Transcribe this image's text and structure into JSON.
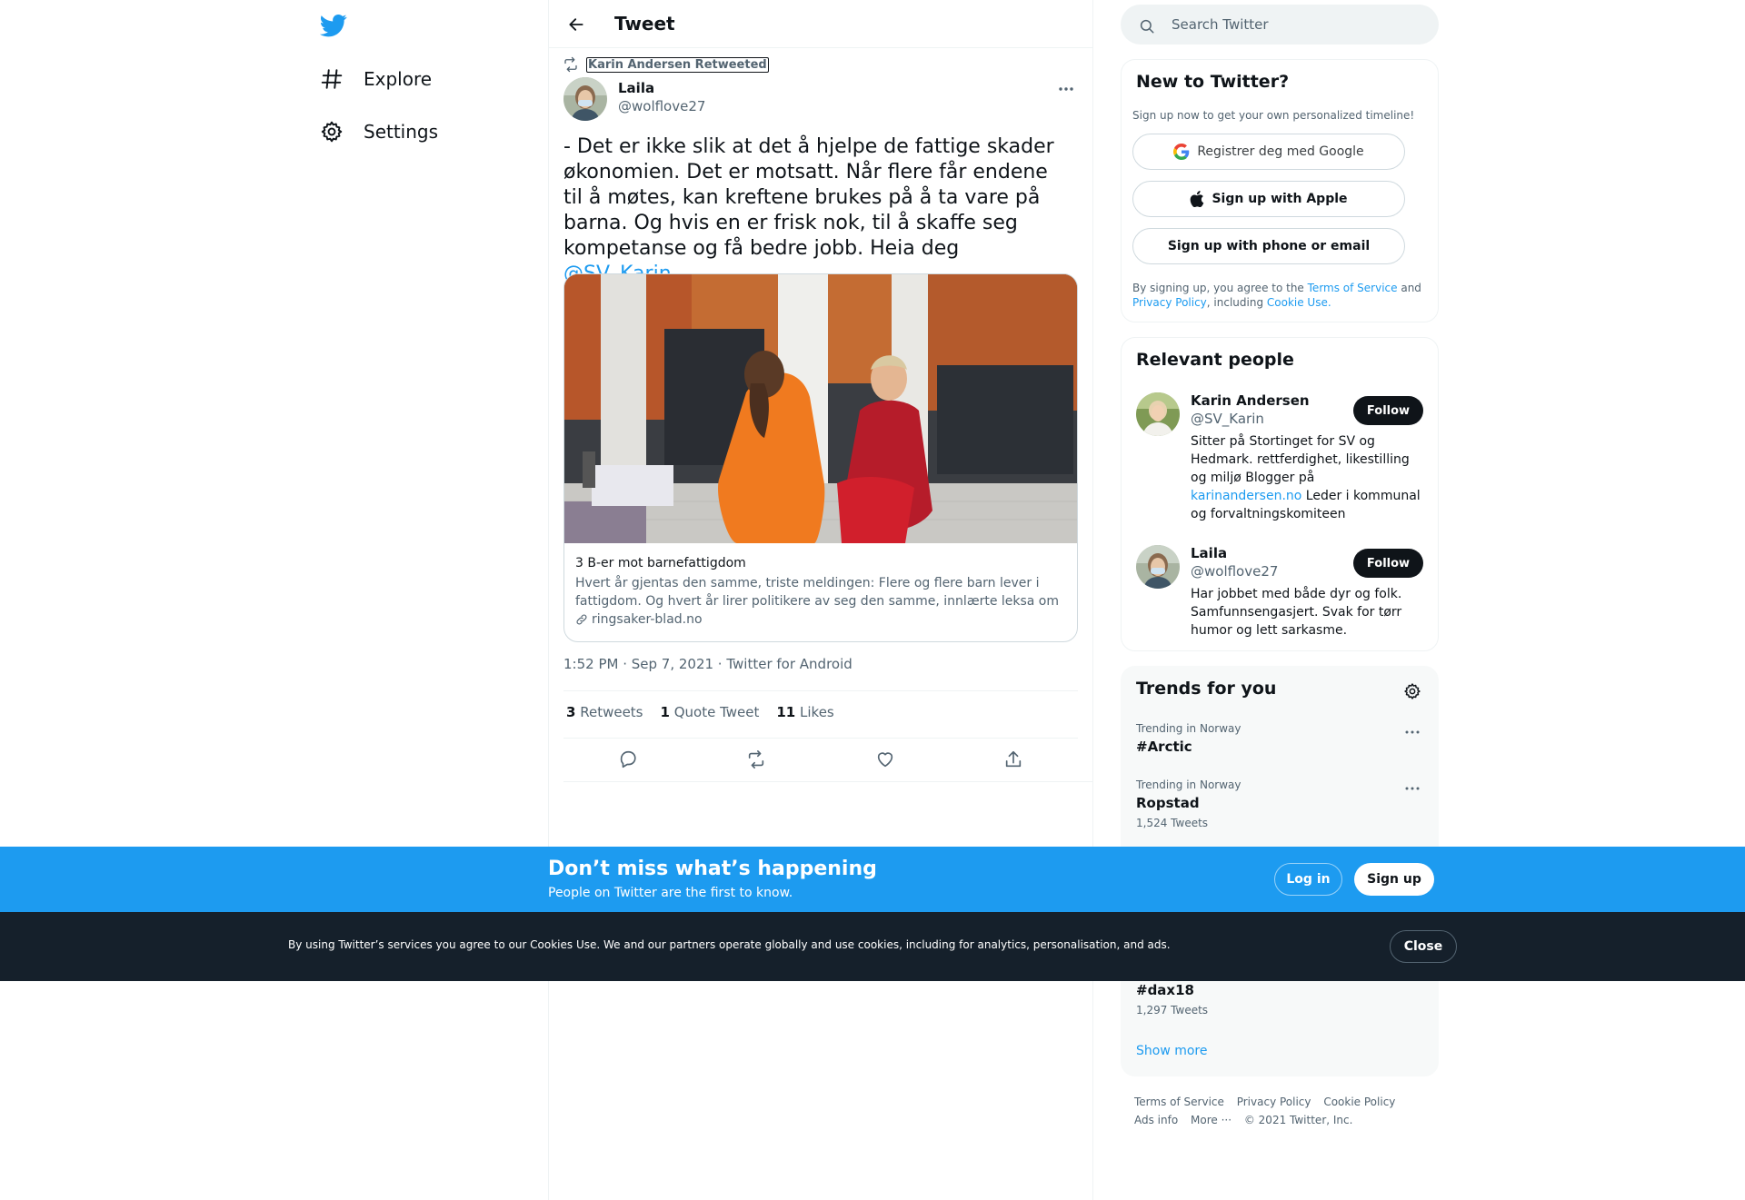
{
  "nav": {
    "logo": "twitter-bird-icon",
    "items": [
      {
        "label": "Explore",
        "icon": "hashtag-icon"
      },
      {
        "label": "Settings",
        "icon": "gear-icon"
      }
    ]
  },
  "header": {
    "title": "Tweet"
  },
  "tweet": {
    "retweeted_by": "Karin Andersen Retweeted",
    "author_name": "Laila",
    "author_handle": "@wolflove27",
    "text_before": "- Det er ikke slik at det å hjelpe de fattige skader økonomien. Det er motsatt. Når flere får endene til å møtes, kan kreftene brukes på å ta vare på barna. Og hvis en er frisk nok, til å skaffe seg kompetanse og få bedre jobb. Heia deg ",
    "mention": "@SV_Karin",
    "text_after": ".",
    "card": {
      "title": "3 B-er mot barnefattigdom",
      "description": "Hvert år gjentas den samme, triste meldingen: Flere og flere barn lever i fattigdom. Og hvert år lirer politikere av seg den samme, innlærte leksa om hvor...",
      "domain": "ringsaker-blad.no"
    },
    "timestamp": "1:52 PM · Sep 7, 2021 · Twitter for Android",
    "stats": {
      "retweets_count": "3",
      "retweets_label": "Retweets",
      "quotes_count": "1",
      "quotes_label": "Quote Tweet",
      "likes_count": "11",
      "likes_label": "Likes"
    }
  },
  "search": {
    "placeholder": "Search Twitter"
  },
  "new_to_twitter": {
    "title": "New to Twitter?",
    "subtitle": "Sign up now to get your own personalized timeline!",
    "google_label": "Registrer deg med Google",
    "apple_label": "Sign up with Apple",
    "phone_label": "Sign up with phone or email",
    "legal_1": "By signing up, you agree to the ",
    "terms": "Terms of Service",
    "legal_2": " and ",
    "privacy": "Privacy Policy",
    "legal_3": ", including ",
    "cookie": "Cookie Use."
  },
  "relevant_people": {
    "title": "Relevant people",
    "follow_label": "Follow",
    "people": [
      {
        "name": "Karin Andersen",
        "handle": "@SV_Karin",
        "bio_before": "Sitter på Stortinget for SV og Hedmark. rettferdighet, likestilling og miljø Blogger på ",
        "bio_link": "karinandersen.no",
        "bio_after": " Leder i kommunal og forvaltningskomiteen"
      },
      {
        "name": "Laila",
        "handle": "@wolflove27",
        "bio_before": "Har jobbet med både dyr og folk. Samfunnsengasjert. Svak for tørr humor og lett sarkasme.",
        "bio_link": "",
        "bio_after": ""
      }
    ]
  },
  "trends": {
    "title": "Trends for you",
    "items": [
      {
        "meta": "Trending in Norway",
        "name": "#Arctic",
        "count": ""
      },
      {
        "meta": "Trending in Norway",
        "name": "Ropstad",
        "count": "1,524 Tweets"
      },
      {
        "meta": "",
        "name": "#dax18",
        "count": "1,297 Tweets"
      }
    ],
    "show_more": "Show more"
  },
  "footer": {
    "links": [
      "Terms of Service",
      "Privacy Policy",
      "Cookie Policy",
      "Ads info",
      "More ···",
      "© 2021 Twitter, Inc."
    ]
  },
  "signup_bar": {
    "title": "Don’t miss what’s happening",
    "subtitle": "People on Twitter are the first to know.",
    "login_label": "Log in",
    "signup_label": "Sign up"
  },
  "cookie_bar": {
    "text": "By using Twitter’s services you agree to our Cookies Use. We and our partners operate globally and use cookies, including for analytics, personalisation, and ads.",
    "close_label": "Close"
  },
  "colors": {
    "accent": "#1d9bf0",
    "text": "#0f1419",
    "muted": "#536471",
    "dark_bar": "#15202b"
  }
}
